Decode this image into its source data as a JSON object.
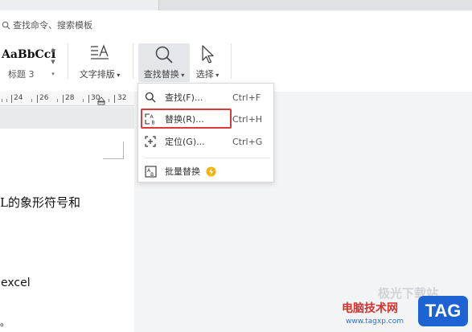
{
  "search": {
    "placeholder": "查找命令、搜索模板"
  },
  "ribbon": {
    "style_preview": "AaBbCcI",
    "style_name": "标题 3",
    "text_layout_label": "文字排版",
    "find_replace_label": "查找替换",
    "select_label": "选择"
  },
  "ruler": {
    "ticks": [
      "24",
      "26",
      "28",
      "30",
      "32"
    ]
  },
  "menu": {
    "items": [
      {
        "label": "查找(F)...",
        "shortcut": "Ctrl+F",
        "icon": "search-icon"
      },
      {
        "label": "替换(R)...",
        "shortcut": "Ctrl+H",
        "icon": "replace-icon"
      },
      {
        "label": "定位(G)...",
        "shortcut": "Ctrl+G",
        "icon": "locate-icon"
      },
      {
        "label": "批量替换",
        "icon": "batch-replace-icon"
      }
    ],
    "highlight_color": "#d93a3a"
  },
  "document": {
    "line1": "L的象形符号和",
    "line2": "excel",
    "line3": "。"
  },
  "watermark": {
    "text": "电脑技术网",
    "url": "www.tagxp.com",
    "badge": "TAG",
    "faint": "极光下载站"
  }
}
